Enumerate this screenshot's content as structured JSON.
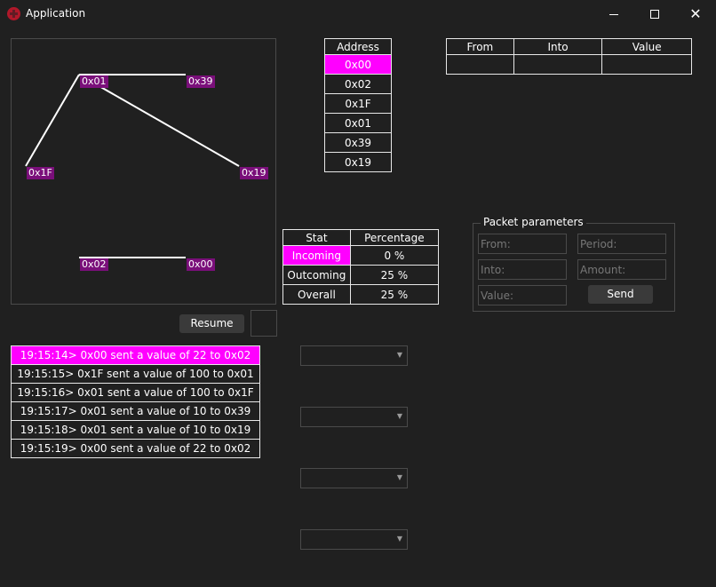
{
  "window": {
    "title": "Application",
    "icon": "app-logo-icon",
    "minimize_icon": "minimize-icon",
    "maximize_icon": "maximize-icon",
    "close_icon": "close-icon",
    "close_glyph": "✕"
  },
  "graph": {
    "nodes": [
      {
        "id": "0x01",
        "label": "0x01"
      },
      {
        "id": "0x39",
        "label": "0x39"
      },
      {
        "id": "0x1F",
        "label": "0x1F"
      },
      {
        "id": "0x19",
        "label": "0x19"
      },
      {
        "id": "0x02",
        "label": "0x02"
      },
      {
        "id": "0x00",
        "label": "0x00"
      }
    ],
    "edges": [
      {
        "from": "0x1F",
        "to": "0x01"
      },
      {
        "from": "0x01",
        "to": "0x39"
      },
      {
        "from": "0x01",
        "to": "0x19"
      },
      {
        "from": "0x02",
        "to": "0x00"
      }
    ],
    "line_color": "#ffffff",
    "label_color": "#7a0f7a"
  },
  "address_table": {
    "header": "Address",
    "rows": [
      "0x00",
      "0x02",
      "0x1F",
      "0x01",
      "0x39",
      "0x19"
    ],
    "selected_index": 0
  },
  "transfer_table": {
    "headers": [
      "From",
      "Into",
      "Value"
    ],
    "rows": [
      [
        "",
        "",
        ""
      ]
    ]
  },
  "stat_table": {
    "headers": [
      "Stat",
      "Percentage"
    ],
    "rows": [
      {
        "stat": "Incoming",
        "percentage": "0 %"
      },
      {
        "stat": "Outcoming",
        "percentage": "25 %"
      },
      {
        "stat": "Overall",
        "percentage": "25 %"
      }
    ],
    "selected_index": 0
  },
  "packet_parameters": {
    "title": "Packet parameters",
    "from_placeholder": "From:",
    "period_placeholder": "Period:",
    "into_placeholder": "Into:",
    "amount_placeholder": "Amount:",
    "value_placeholder": "Value:",
    "send_label": "Send"
  },
  "controls": {
    "resume_label": "Resume"
  },
  "log": {
    "entries": [
      "19:15:14> 0x00 sent a value of 22 to 0x02",
      "19:15:15> 0x1F sent a value of 100 to 0x01",
      "19:15:16> 0x01 sent a value of 100 to 0x1F",
      "19:15:17> 0x01 sent a value of 10 to 0x39",
      "19:15:18> 0x01 sent a value of 10 to 0x19",
      "19:15:19> 0x00 sent a value of 22 to 0x02"
    ],
    "selected_index": 0
  },
  "dropdowns": [
    {
      "value": "",
      "icon": "chevron-down-icon"
    },
    {
      "value": "",
      "icon": "chevron-down-icon"
    },
    {
      "value": "",
      "icon": "chevron-down-icon"
    },
    {
      "value": "",
      "icon": "chevron-down-icon"
    }
  ],
  "colors": {
    "accent": "#ff00ff",
    "background": "#202020",
    "node_label": "#7a0f7a",
    "app_icon": "#b0182a"
  }
}
